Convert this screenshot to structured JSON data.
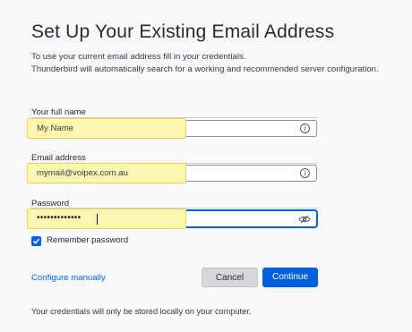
{
  "header": {
    "title": "Set Up Your Existing Email Address",
    "description_line1": "To use your current email address fill in your credentials.",
    "description_line2": "Thunderbird will automatically search for a working and recommended server configuration."
  },
  "form": {
    "full_name": {
      "label": "Your full name",
      "value": "My Name",
      "icon": "info-icon"
    },
    "email": {
      "label": "Email address",
      "value": "mymail@voipex.com.au",
      "icon": "info-icon"
    },
    "password": {
      "label": "Password",
      "masked_value": "•••••••••••••",
      "icon": "eye-slash-icon"
    },
    "remember_password": {
      "label": "Remember password",
      "checked": true
    }
  },
  "actions": {
    "configure_manually": "Configure manually",
    "cancel": "Cancel",
    "continue": "Continue"
  },
  "footer": {
    "note": "Your credentials will only be stored locally on your computer."
  },
  "colors": {
    "accent": "#0060df",
    "highlight": "#fff7b0",
    "highlight_border": "#ecd35a"
  }
}
